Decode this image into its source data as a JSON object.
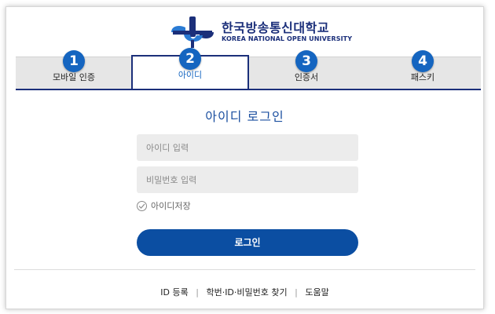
{
  "logo": {
    "name_ko": "한국방송통신대학교",
    "name_en": "KOREA NATIONAL OPEN UNIVERSITY"
  },
  "tabs": [
    {
      "num": "1",
      "label": "모바일 인증",
      "active": false
    },
    {
      "num": "2",
      "label": "아이디",
      "active": true
    },
    {
      "num": "3",
      "label": "인증서",
      "active": false
    },
    {
      "num": "4",
      "label": "패스키",
      "active": false
    }
  ],
  "form": {
    "title": "아이디 로그인",
    "id_placeholder": "아이디 입력",
    "id_value": "",
    "pw_placeholder": "비밀번호 입력",
    "pw_value": "",
    "save_id_label": "아이디저장",
    "save_id_checked": false,
    "login_button": "로그인"
  },
  "footer": {
    "links": [
      "ID 등록",
      "학번·ID·비밀번호 찾기",
      "도움말"
    ],
    "separator": "|"
  },
  "colors": {
    "brand_navy": "#1b2f7a",
    "accent_blue": "#1565c0",
    "button_blue": "#0b4ea2",
    "tab_inactive_bg": "#e6e6e6",
    "field_bg": "#ececec"
  },
  "icons": {
    "logo": "knou-emblem-icon",
    "save_id": "check-circle-icon"
  }
}
